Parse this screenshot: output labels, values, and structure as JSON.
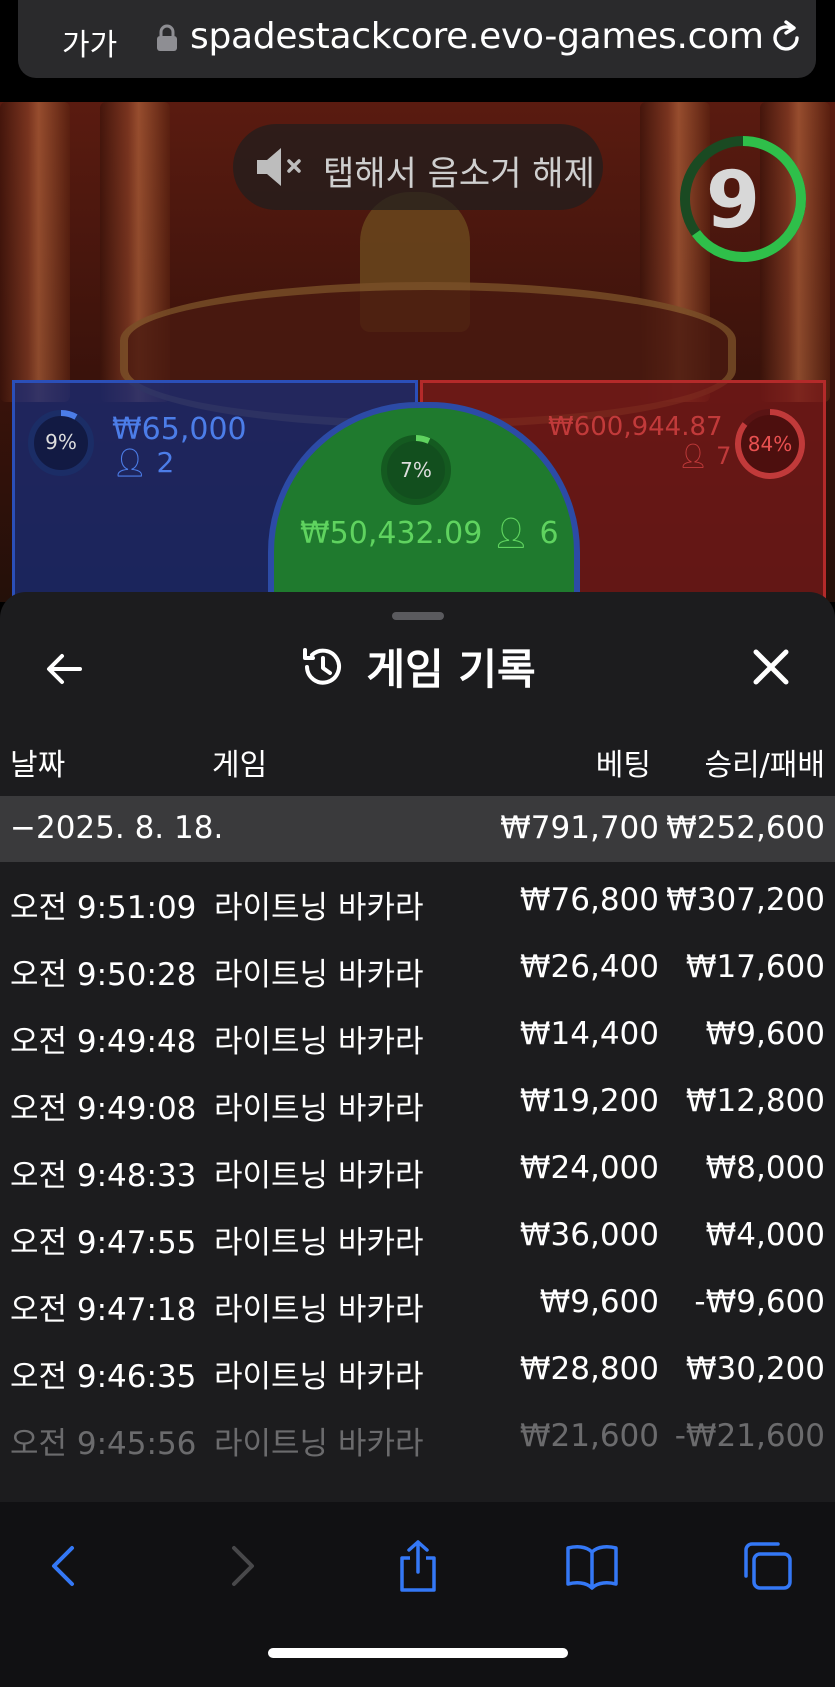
{
  "browser": {
    "text_size_label": "가가",
    "url": "spadestackcore.evo-games.com"
  },
  "game": {
    "mute_hint": "탭해서 음소거 해제",
    "countdown": "9",
    "player": {
      "percent": "9%",
      "amount": "₩65,000",
      "players": "2",
      "color": "#4c7de8"
    },
    "tie": {
      "percent": "7%",
      "amount": "₩50,432.09",
      "players": "6",
      "color": "#5fd35f"
    },
    "banker": {
      "percent": "84%",
      "amount": "₩600,944.87",
      "players": "7",
      "color": "#c13a3a"
    }
  },
  "sheet": {
    "title": "게임 기록",
    "columns": {
      "date": "날짜",
      "game": "게임",
      "bet": "베팅",
      "win_loss": "승리/패배"
    },
    "summary": {
      "date": "−2025. 8. 18.",
      "bet": "₩791,700",
      "win_loss": "₩252,600"
    },
    "rows": [
      {
        "time": "오전 9:51:09",
        "game": "라이트닝 바카라",
        "bet": "₩76,800",
        "result": "₩307,200"
      },
      {
        "time": "오전 9:50:28",
        "game": "라이트닝 바카라",
        "bet": "₩26,400",
        "result": "₩17,600"
      },
      {
        "time": "오전 9:49:48",
        "game": "라이트닝 바카라",
        "bet": "₩14,400",
        "result": "₩9,600"
      },
      {
        "time": "오전 9:49:08",
        "game": "라이트닝 바카라",
        "bet": "₩19,200",
        "result": "₩12,800"
      },
      {
        "time": "오전 9:48:33",
        "game": "라이트닝 바카라",
        "bet": "₩24,000",
        "result": "₩8,000"
      },
      {
        "time": "오전 9:47:55",
        "game": "라이트닝 바카라",
        "bet": "₩36,000",
        "result": "₩4,000"
      },
      {
        "time": "오전 9:47:18",
        "game": "라이트닝 바카라",
        "bet": "₩9,600",
        "result": "-₩9,600"
      },
      {
        "time": "오전 9:46:35",
        "game": "라이트닝 바카라",
        "bet": "₩28,800",
        "result": "₩30,200"
      },
      {
        "time": "오전 9:45:56",
        "game": "라이트닝 바카라",
        "bet": "₩21,600",
        "result": "-₩21,600"
      }
    ]
  },
  "toolbar_icons": [
    "back-icon",
    "forward-icon",
    "share-icon",
    "bookmarks-icon",
    "tabs-icon"
  ],
  "accent_color": "#3478f6"
}
